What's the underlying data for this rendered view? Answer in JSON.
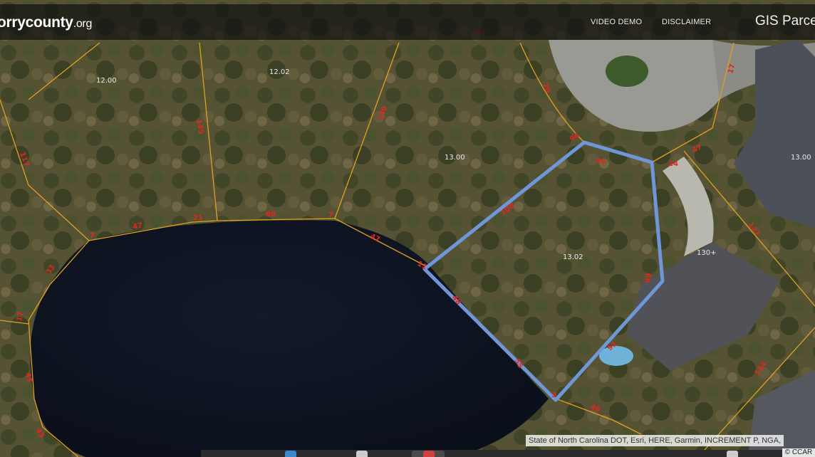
{
  "header": {
    "brand_main": "orrycounty",
    "brand_tld": ".org",
    "nav": [
      {
        "label": "VIDEO DEMO"
      },
      {
        "label": "DISCLAIMER"
      }
    ],
    "app_title": "GIS Parcel"
  },
  "map": {
    "parcel_ids": [
      "12.00",
      "12.02",
      "13.00",
      "13.02",
      "130+",
      "13.00"
    ],
    "lot_line_labels": [
      "20",
      "17",
      "145",
      "140",
      "100",
      "7",
      "47",
      "21",
      "80",
      "7",
      "47",
      "11",
      "94",
      "49",
      "24",
      "47",
      "117",
      "48",
      "69",
      "91",
      "55",
      "3",
      "46",
      "127",
      "154",
      "33",
      "17",
      "45",
      "43",
      "27"
    ],
    "selected_parcel_color": "#6f96d6",
    "lot_line_color": "#e0a020",
    "label_color": "#e3261f"
  },
  "footer": {
    "attribution": "State of North Carolina DOT, Esri, HERE, Garmin, INCREMENT P, NGA,",
    "copyright": "© CCAR"
  }
}
